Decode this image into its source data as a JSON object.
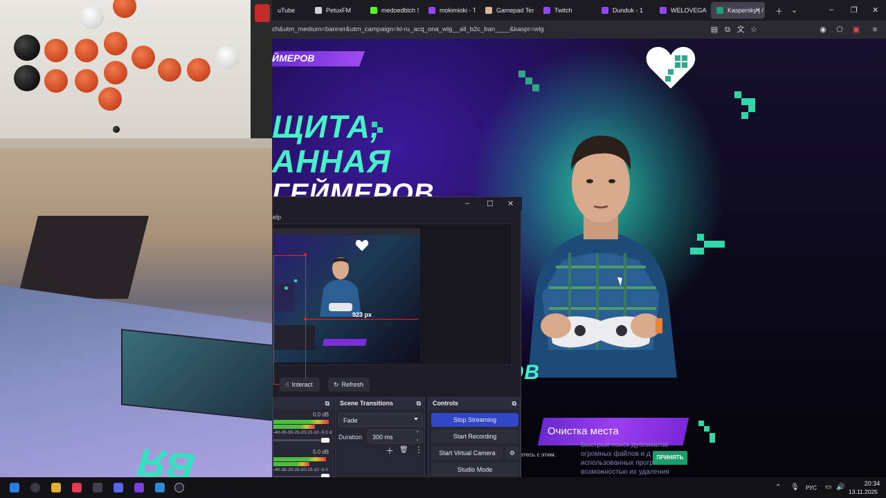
{
  "browser": {
    "tabs": [
      {
        "label": "uTube",
        "icon": "youtube-icon",
        "color": "#e53935",
        "active": false
      },
      {
        "label": "PetuxFM",
        "icon": "speaker-icon",
        "color": "#d0d0d6",
        "active": false
      },
      {
        "label": "medoedblch St",
        "icon": "kick-icon",
        "color": "#53fc18",
        "active": false
      },
      {
        "label": "mokimioki - Tw",
        "icon": "twitch-icon",
        "color": "#9146ff",
        "active": false
      },
      {
        "label": "Gamepad Teste",
        "icon": "gamepad-icon",
        "color": "#d7b89a",
        "active": false
      },
      {
        "label": "Twitch",
        "icon": "twitch-icon",
        "color": "#9146ff",
        "active": false
      },
      {
        "label": "Dunduk - 1",
        "icon": "twitch-icon",
        "color": "#9146ff",
        "active": false
      },
      {
        "label": "WELOVEGAME",
        "icon": "twitch-icon",
        "color": "#9146ff",
        "active": false
      },
      {
        "label": "Kaspersky | /",
        "icon": "kaspersky-icon",
        "color": "#1aa37a",
        "active": true
      }
    ],
    "url": "ch&utm_medium=banner&utm_campaign=kl-ru_acq_ona_wlg__all_b2c_ban____&kaspr=wlg"
  },
  "page": {
    "brush_label": "ЙМЕРОВ",
    "hero_line1": "ЩИТА,",
    "hero_line2": "АННАЯ",
    "hero_line3": "ГЕЙМЕРОВ",
    "footer_brush": "ОВ",
    "promo_title": "Очистка места",
    "promo_sub": "Быстрый поиск дубликатов огромных файлов и д использованных прогр возможностью их удаления",
    "cookie_text": "ьетесь с этим.",
    "accept_label": "ПРИНЯТЬ",
    "accent": "#47f0c8"
  },
  "obs": {
    "menu_fragment": "elp",
    "preview_size_label": "923 px",
    "interact_label": "Interact",
    "refresh_label": "Refresh",
    "mixer": {
      "track1_db": "0.0 dB",
      "track2_db": "5.0 dB",
      "scale": "-40-35-30-25-20-15-10 -5 0",
      "scale_cut": "d"
    },
    "scene_transitions": {
      "title": "Scene Transitions",
      "selected": "Fade",
      "duration_label": "Duration",
      "duration_value": "300 ms"
    },
    "controls": {
      "title": "Controls",
      "stop_streaming": "Stop Streaming",
      "start_recording": "Start Recording",
      "start_virtual_camera": "Start Virtual Camera",
      "studio_mode": "Studio Mode"
    }
  },
  "taskbar": {
    "lang": "РУС",
    "time": "20:34",
    "date": "13.11.2025"
  }
}
